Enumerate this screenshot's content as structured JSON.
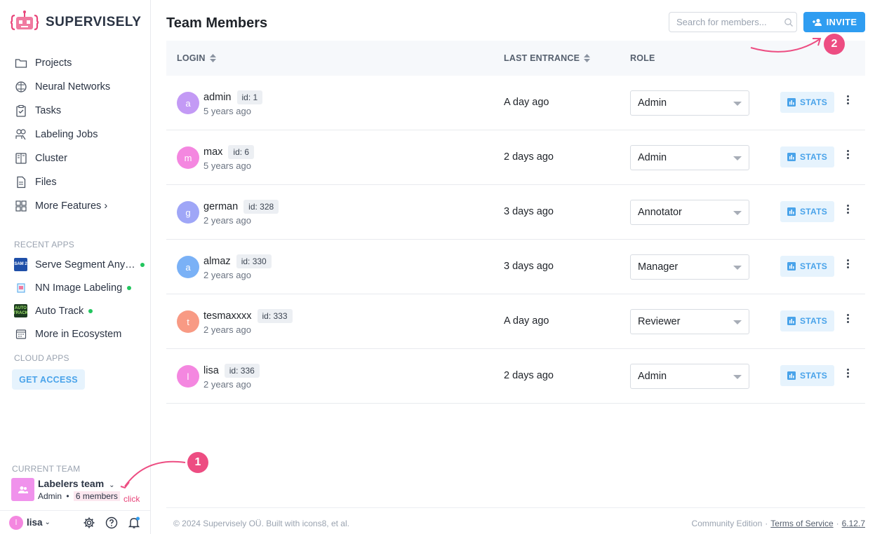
{
  "brand": {
    "name": "SUPERVISELY"
  },
  "nav": [
    {
      "label": "Projects",
      "icon": "folder-icon"
    },
    {
      "label": "Neural Networks",
      "icon": "brain-icon"
    },
    {
      "label": "Tasks",
      "icon": "clipboard-icon"
    },
    {
      "label": "Labeling Jobs",
      "icon": "labeling-jobs-icon"
    },
    {
      "label": "Cluster",
      "icon": "cluster-icon"
    },
    {
      "label": "Files",
      "icon": "file-icon"
    },
    {
      "label": "More Features ›",
      "icon": "grid-icon"
    }
  ],
  "recent_apps": {
    "title": "RECENT APPS",
    "items": [
      {
        "label": "Serve Segment Any…",
        "badge": "SAM 2",
        "running": true
      },
      {
        "label": "NN Image Labeling",
        "badge": "",
        "running": true
      },
      {
        "label": "Auto Track",
        "badge": "AUTO TRACK",
        "running": true
      },
      {
        "label": "More in Ecosystem",
        "badge": "",
        "running": false
      }
    ]
  },
  "cloud_apps": {
    "title": "CLOUD APPS",
    "button": "GET ACCESS"
  },
  "current_team": {
    "title": "CURRENT TEAM",
    "name": "Labelers team",
    "role": "Admin",
    "separator": "•",
    "members": "6 members",
    "annotation": "click",
    "step": "1"
  },
  "user": {
    "name": "lisa",
    "initial": "l"
  },
  "header": {
    "title": "Team Members",
    "search_placeholder": "Search for members...",
    "invite_label": "INVITE",
    "step": "2"
  },
  "table": {
    "columns": {
      "login": "LOGIN",
      "last_entrance": "LAST ENTRANCE",
      "role": "ROLE"
    },
    "stats_label": "STATS",
    "rows": [
      {
        "initial": "a",
        "color": "#c39af5",
        "login": "admin",
        "id": "id: 1",
        "joined": "5 years ago",
        "last": "A day ago",
        "role": "Admin"
      },
      {
        "initial": "m",
        "color": "#f487e0",
        "login": "max",
        "id": "id: 6",
        "joined": "5 years ago",
        "last": "2 days ago",
        "role": "Admin"
      },
      {
        "initial": "g",
        "color": "#9fa6f7",
        "login": "german",
        "id": "id: 328",
        "joined": "2 years ago",
        "last": "3 days ago",
        "role": "Annotator"
      },
      {
        "initial": "a",
        "color": "#7ab1f6",
        "login": "almaz",
        "id": "id: 330",
        "joined": "2 years ago",
        "last": "3 days ago",
        "role": "Manager"
      },
      {
        "initial": "t",
        "color": "#f89a84",
        "login": "tesmaxxxx",
        "id": "id: 333",
        "joined": "2 years ago",
        "last": "A day ago",
        "role": "Reviewer"
      },
      {
        "initial": "l",
        "color": "#f487e0",
        "login": "lisa",
        "id": "id: 336",
        "joined": "2 years ago",
        "last": "2 days ago",
        "role": "Admin"
      }
    ]
  },
  "footer": {
    "copyright": "© 2024 Supervisely OÜ. Built with icons8, et al.",
    "edition": "Community Edition",
    "sep": "·",
    "terms": "Terms of Service",
    "version": "6.12.7"
  },
  "colors": {
    "accent": "#2f9df1",
    "annotation": "#ed4d82"
  }
}
